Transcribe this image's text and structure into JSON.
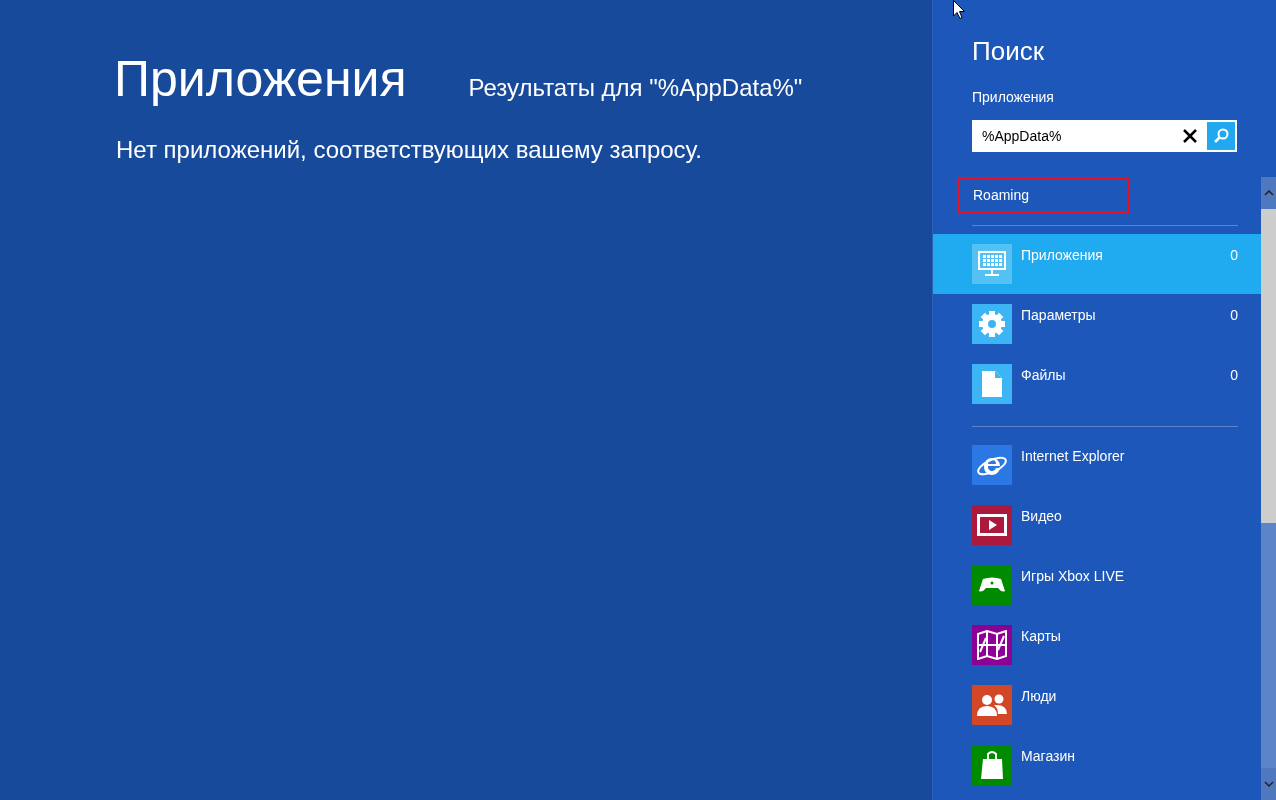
{
  "main": {
    "title": "Приложения",
    "results_label": "Результаты для \"%AppData%\"",
    "message": "Нет приложений, соответствующих вашему запросу."
  },
  "search_pane": {
    "title": "Поиск",
    "scope": "Приложения",
    "search": {
      "value": "%AppData%"
    },
    "suggestions": [
      {
        "label": "Roaming",
        "highlighted": true
      }
    ],
    "categories": [
      {
        "label": "Приложения",
        "count": "0",
        "kind": "apps",
        "selected": true
      },
      {
        "label": "Параметры",
        "count": "0",
        "kind": "settings",
        "selected": false
      },
      {
        "label": "Файлы",
        "count": "0",
        "kind": "files",
        "selected": false
      }
    ],
    "apps": [
      {
        "label": "Internet Explorer",
        "kind": "browser",
        "color": "#2b78e4"
      },
      {
        "label": "Видео",
        "kind": "video",
        "color": "#ac193d"
      },
      {
        "label": "Игры Xbox LIVE",
        "kind": "games",
        "color": "#008a00"
      },
      {
        "label": "Карты",
        "kind": "maps",
        "color": "#8c0095"
      },
      {
        "label": "Люди",
        "kind": "people",
        "color": "#d24726"
      },
      {
        "label": "Магазин",
        "kind": "store",
        "color": "#008a00"
      }
    ]
  }
}
